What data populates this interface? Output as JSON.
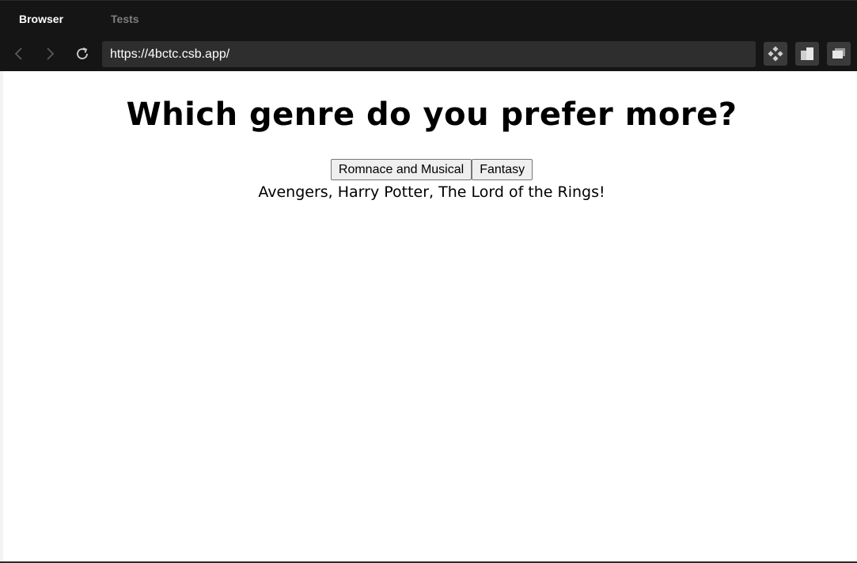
{
  "browser": {
    "tabs": [
      {
        "label": "Browser",
        "active": true
      },
      {
        "label": "Tests",
        "active": false
      }
    ],
    "url": "https://4bctc.csb.app/",
    "nav_icons": [
      "back-arrow-icon",
      "forward-arrow-icon",
      "reload-icon"
    ],
    "toolbar_icons": [
      "codesandbox-icon",
      "split-view-icon",
      "open-new-window-icon"
    ]
  },
  "page": {
    "heading": "Which genre do you prefer more?",
    "buttons": [
      "Romnace and Musical",
      "Fantasy"
    ],
    "result_text": "Avengers, Harry Potter, The Lord of the Rings!"
  },
  "colors": {
    "chrome_bg": "#151515",
    "url_bg": "#2e2e2e",
    "inactive_tab": "#7d7d7d",
    "page_bg": "#ffffff"
  }
}
